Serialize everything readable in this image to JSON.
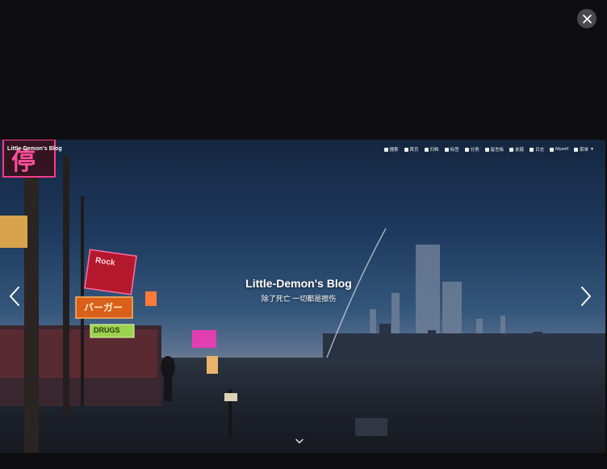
{
  "lightbox": {
    "close_icon": "close-icon",
    "prev_icon": "chevron-left-icon",
    "next_icon": "chevron-right-icon"
  },
  "blog": {
    "brand": "Little-Demon's Blog",
    "nav": [
      {
        "icon": "search-icon",
        "label": "搜索"
      },
      {
        "icon": "home-icon",
        "label": "首页"
      },
      {
        "icon": "archive-icon",
        "label": "归档"
      },
      {
        "icon": "tag-icon",
        "label": "标签"
      },
      {
        "icon": "folder-icon",
        "label": "分类"
      },
      {
        "icon": "send-icon",
        "label": "留言板"
      },
      {
        "icon": "link-icon",
        "label": "友链"
      },
      {
        "icon": "bell-icon",
        "label": "日志"
      },
      {
        "icon": "card-icon",
        "label": "Myself"
      },
      {
        "icon": "list-icon",
        "label": "菜单"
      }
    ],
    "hero_title": "Little-Demon's Blog",
    "hero_subtitle": "除了死亡 一切都是擦伤",
    "scroll_icon": "chevron-down-icon",
    "signs": {
      "kanji": "停",
      "rock": "Rock",
      "burger": "バーガー",
      "drugs": "DRUGS"
    }
  }
}
